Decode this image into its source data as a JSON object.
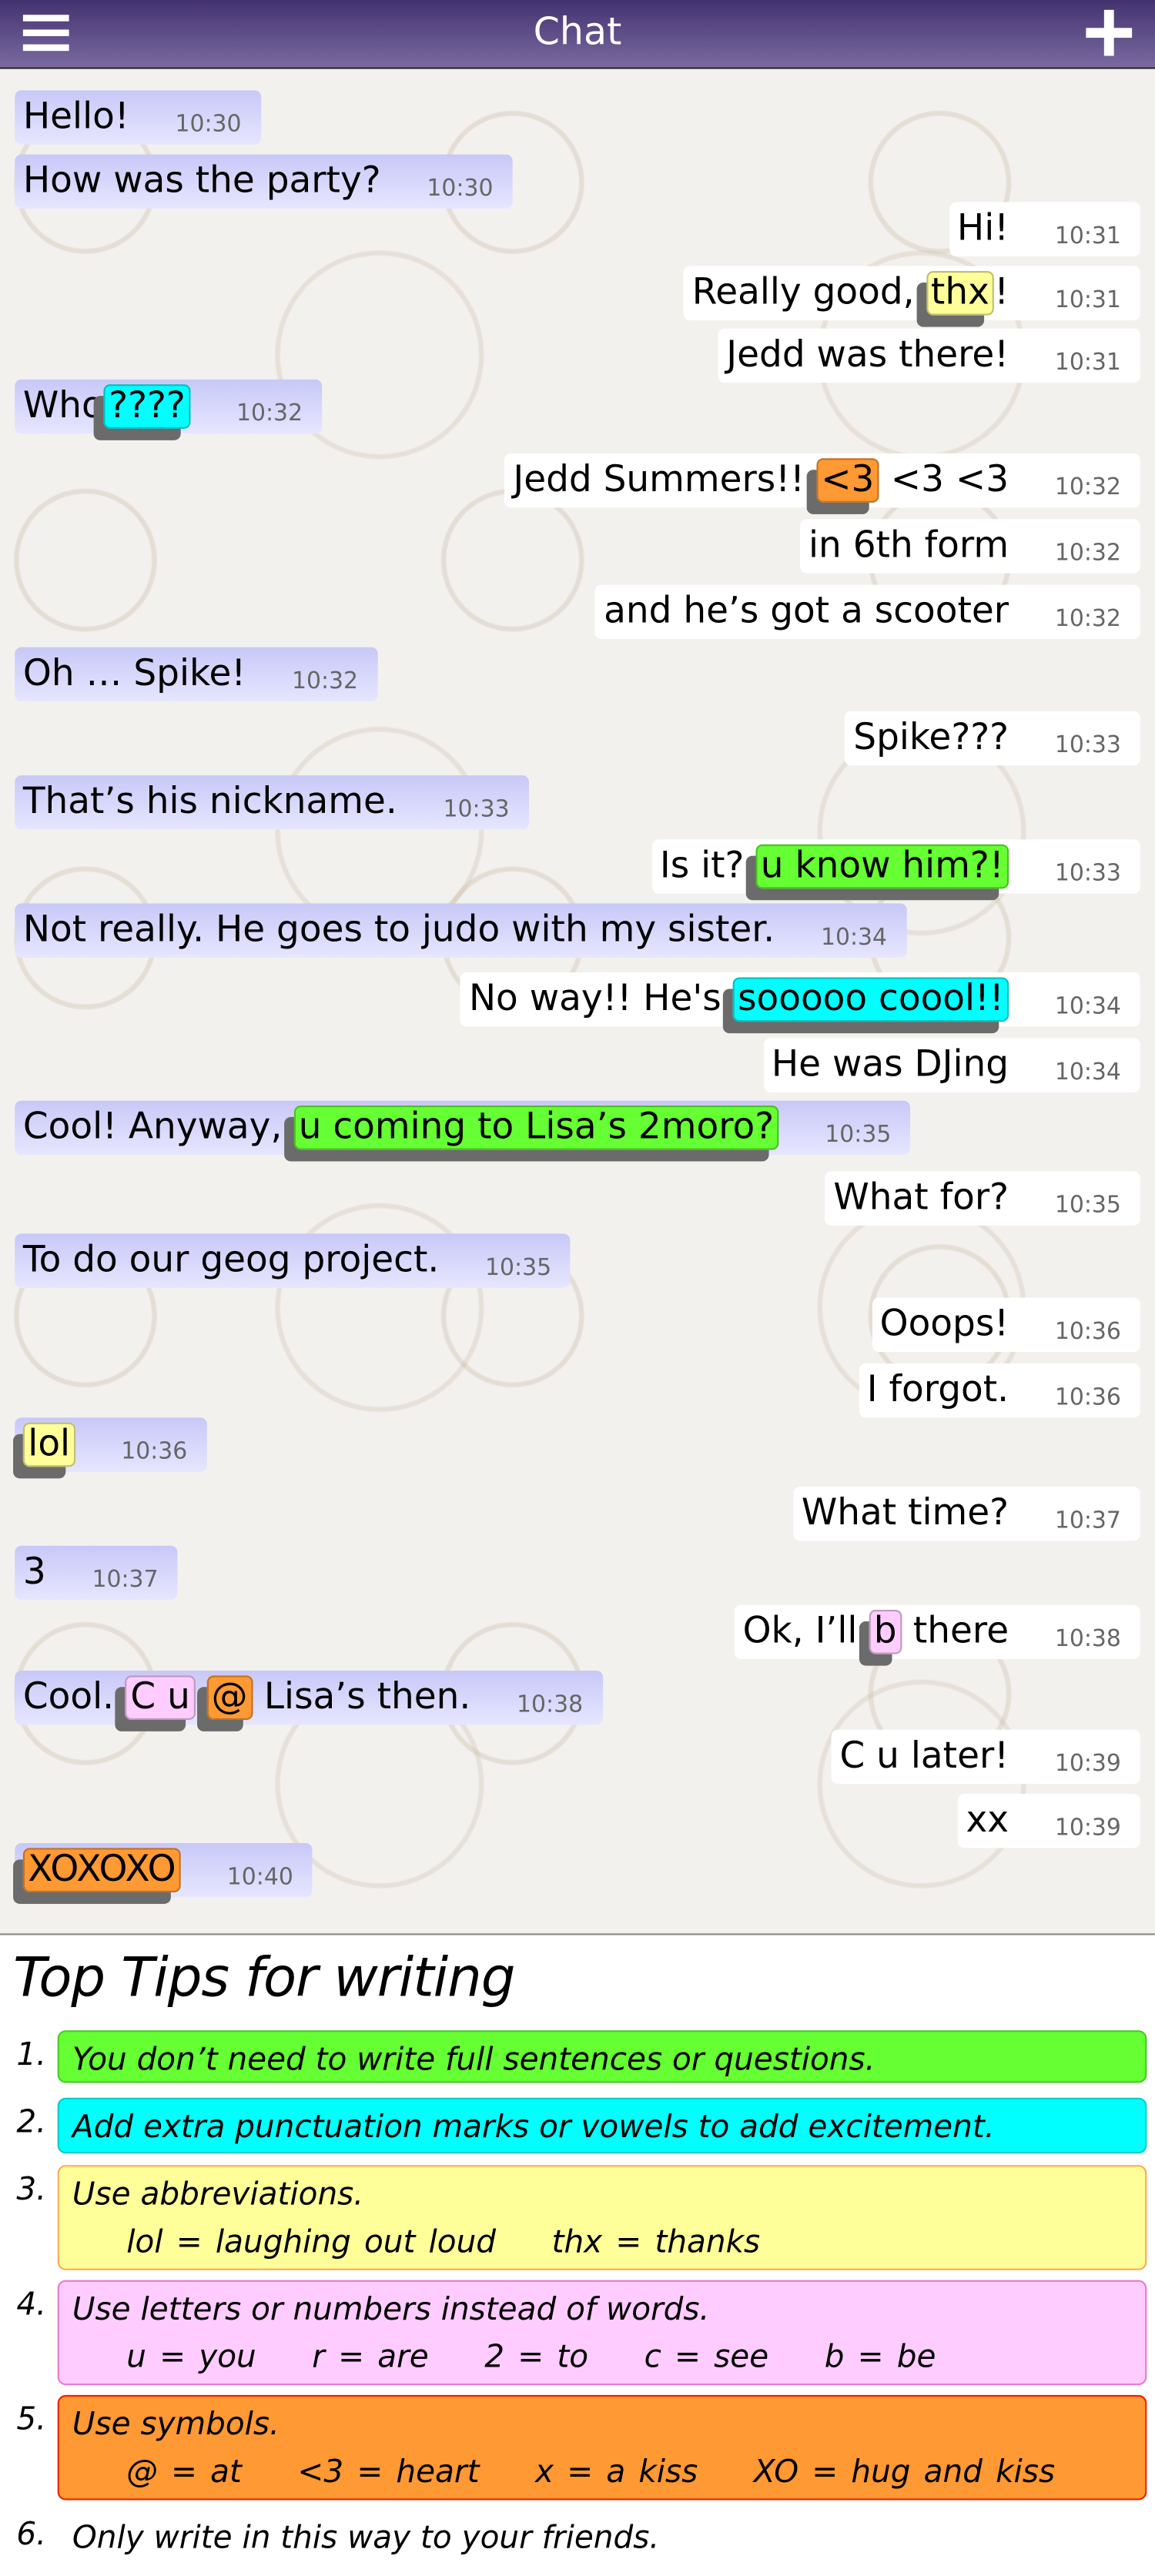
{
  "header": {
    "title": "Chat",
    "menu_icon": "hamburger-menu-icon",
    "add_icon": "plus-icon"
  },
  "colors": {
    "yellow": "#ffff99",
    "cyan": "#00ffff",
    "orange": "#ff9933",
    "green": "#66ff33",
    "pink": "#ffccff",
    "header": "#5a4a88"
  },
  "messages": [
    {
      "side": "left",
      "time": "10:30",
      "segments": [
        {
          "t": "Hello!"
        }
      ]
    },
    {
      "side": "left",
      "time": "10:30",
      "segments": [
        {
          "t": "How was the party?"
        }
      ]
    },
    {
      "side": "right",
      "time": "10:31",
      "segments": [
        {
          "t": "Hi!"
        }
      ]
    },
    {
      "side": "right",
      "time": "10:31",
      "segments": [
        {
          "t": "Really good, "
        },
        {
          "t": "thx",
          "hl": "yellow"
        },
        {
          "t": "!"
        }
      ]
    },
    {
      "side": "right",
      "time": "10:31",
      "segments": [
        {
          "t": "Jedd was there!"
        }
      ]
    },
    {
      "side": "left",
      "time": "10:32",
      "segments": [
        {
          "t": "Who"
        },
        {
          "t": "????",
          "hl": "cyan"
        }
      ]
    },
    {
      "side": "right",
      "time": "10:32",
      "segments": [
        {
          "t": "Jedd Summers!! "
        },
        {
          "t": "<3",
          "hl": "orange"
        },
        {
          "t": " <3 <3"
        }
      ]
    },
    {
      "side": "right",
      "time": "10:32",
      "segments": [
        {
          "t": "in 6th form"
        }
      ]
    },
    {
      "side": "right",
      "time": "10:32",
      "segments": [
        {
          "t": "and he’s got a scooter"
        }
      ]
    },
    {
      "side": "left",
      "time": "10:32",
      "segments": [
        {
          "t": "Oh … Spike!"
        }
      ]
    },
    {
      "side": "right",
      "time": "10:33",
      "segments": [
        {
          "t": "Spike???"
        }
      ]
    },
    {
      "side": "left",
      "time": "10:33",
      "segments": [
        {
          "t": "That’s his nickname."
        }
      ]
    },
    {
      "side": "right",
      "time": "10:33",
      "segments": [
        {
          "t": "Is it? "
        },
        {
          "t": "u know him?!",
          "hl": "green"
        }
      ]
    },
    {
      "side": "left",
      "time": "10:34",
      "segments": [
        {
          "t": "Not really. He goes to judo with my sister."
        }
      ]
    },
    {
      "side": "right",
      "time": "10:34",
      "segments": [
        {
          "t": "No way!! He's "
        },
        {
          "t": "sooooo coool!!",
          "hl": "cyan"
        }
      ]
    },
    {
      "side": "right",
      "time": "10:34",
      "segments": [
        {
          "t": "He was DJing"
        }
      ]
    },
    {
      "side": "left",
      "time": "10:35",
      "segments": [
        {
          "t": "Cool! Anyway, "
        },
        {
          "t": "u coming to Lisa’s 2moro?",
          "hl": "green"
        }
      ]
    },
    {
      "side": "right",
      "time": "10:35",
      "segments": [
        {
          "t": "What for?"
        }
      ]
    },
    {
      "side": "left",
      "time": "10:35",
      "segments": [
        {
          "t": "To do our geog project."
        }
      ]
    },
    {
      "side": "right",
      "time": "10:36",
      "segments": [
        {
          "t": "Ooops!"
        }
      ]
    },
    {
      "side": "right",
      "time": "10:36",
      "segments": [
        {
          "t": "I forgot."
        }
      ]
    },
    {
      "side": "left",
      "time": "10:36",
      "segments": [
        {
          "t": "lol",
          "hl": "yellow"
        }
      ]
    },
    {
      "side": "right",
      "time": "10:37",
      "segments": [
        {
          "t": "What time?"
        }
      ]
    },
    {
      "side": "left",
      "time": "10:37",
      "segments": [
        {
          "t": "3"
        }
      ]
    },
    {
      "side": "right",
      "time": "10:38",
      "segments": [
        {
          "t": "Ok, I’ll "
        },
        {
          "t": "b",
          "hl": "pink"
        },
        {
          "t": " there"
        }
      ]
    },
    {
      "side": "left",
      "time": "10:38",
      "segments": [
        {
          "t": "Cool. "
        },
        {
          "t": "C u",
          "hl": "pink"
        },
        {
          "t": " "
        },
        {
          "t": "@",
          "hl": "orange"
        },
        {
          "t": " Lisa’s then."
        }
      ]
    },
    {
      "side": "right",
      "time": "10:39",
      "segments": [
        {
          "t": "C u later!"
        }
      ]
    },
    {
      "side": "right",
      "time": "10:39",
      "segments": [
        {
          "t": "xx"
        }
      ]
    },
    {
      "side": "left",
      "time": "10:40",
      "segments": [
        {
          "t": "XOXOXO",
          "hl": "orange"
        }
      ]
    }
  ],
  "tips": {
    "title": "Top Tips for writing",
    "items": [
      {
        "num": "1.",
        "text": "You don’t need to write full sentences or questions.",
        "color": "green",
        "sub": []
      },
      {
        "num": "2.",
        "text": "Add extra punctuation marks or vowels to add excitement.",
        "color": "cyan",
        "sub": []
      },
      {
        "num": "3.",
        "text": "Use abbreviations.",
        "color": "yellow",
        "sub": [
          "lol = laughing out loud",
          "thx = thanks"
        ]
      },
      {
        "num": "4.",
        "text": "Use letters or numbers instead of words.",
        "color": "pink",
        "sub": [
          "u = you",
          "r = are",
          "2 = to",
          "c = see",
          "b = be"
        ]
      },
      {
        "num": "5.",
        "text": "Use symbols.",
        "color": "orange",
        "sub": [
          "@ = at",
          "<3 = heart",
          "x = a kiss",
          "XO = hug and kiss"
        ]
      },
      {
        "num": "6.",
        "text": "Only write in this way to your friends.",
        "color": "",
        "sub": []
      }
    ]
  }
}
